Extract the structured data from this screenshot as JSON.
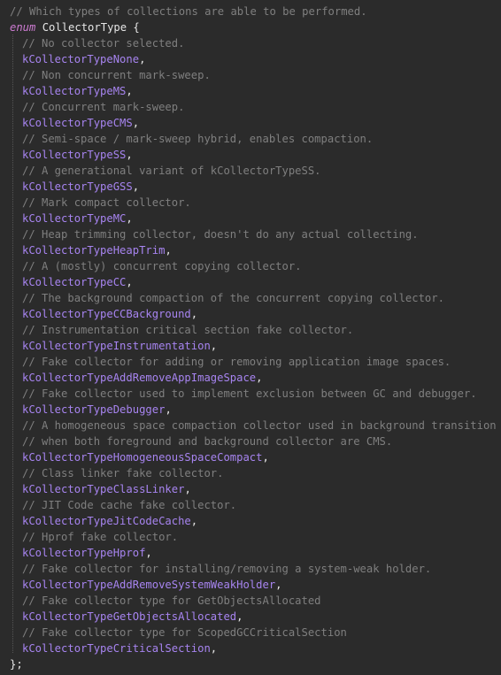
{
  "header_comment": "// Which types of collections are able to be performed.",
  "enum_keyword": "enum",
  "enum_name": " CollectorType {",
  "entries": [
    {
      "comment": "// No collector selected.",
      "value": "kCollectorTypeNone"
    },
    {
      "comment": "// Non concurrent mark-sweep.",
      "value": "kCollectorTypeMS"
    },
    {
      "comment": "// Concurrent mark-sweep.",
      "value": "kCollectorTypeCMS"
    },
    {
      "comment": "// Semi-space / mark-sweep hybrid, enables compaction.",
      "value": "kCollectorTypeSS"
    },
    {
      "comment": "// A generational variant of kCollectorTypeSS.",
      "value": "kCollectorTypeGSS"
    },
    {
      "comment": "// Mark compact collector.",
      "value": "kCollectorTypeMC"
    },
    {
      "comment": "// Heap trimming collector, doesn't do any actual collecting.",
      "value": "kCollectorTypeHeapTrim"
    },
    {
      "comment": "// A (mostly) concurrent copying collector.",
      "value": "kCollectorTypeCC"
    },
    {
      "comment": "// The background compaction of the concurrent copying collector.",
      "value": "kCollectorTypeCCBackground"
    },
    {
      "comment": "// Instrumentation critical section fake collector.",
      "value": "kCollectorTypeInstrumentation"
    },
    {
      "comment": "// Fake collector for adding or removing application image spaces.",
      "value": "kCollectorTypeAddRemoveAppImageSpace"
    },
    {
      "comment": "// Fake collector used to implement exclusion between GC and debugger.",
      "value": "kCollectorTypeDebugger"
    },
    {
      "comment": "// A homogeneous space compaction collector used in background transition",
      "comment2": "// when both foreground and background collector are CMS.",
      "value": "kCollectorTypeHomogeneousSpaceCompact"
    },
    {
      "comment": "// Class linker fake collector.",
      "value": "kCollectorTypeClassLinker"
    },
    {
      "comment": "// JIT Code cache fake collector.",
      "value": "kCollectorTypeJitCodeCache"
    },
    {
      "comment": "// Hprof fake collector.",
      "value": "kCollectorTypeHprof"
    },
    {
      "comment": "// Fake collector for installing/removing a system-weak holder.",
      "value": "kCollectorTypeAddRemoveSystemWeakHolder"
    },
    {
      "comment": "// Fake collector type for GetObjectsAllocated",
      "value": "kCollectorTypeGetObjectsAllocated"
    },
    {
      "comment": "// Fake collector type for ScopedGCCriticalSection",
      "value": "kCollectorTypeCriticalSection"
    }
  ],
  "separator": ",",
  "closing": "};"
}
